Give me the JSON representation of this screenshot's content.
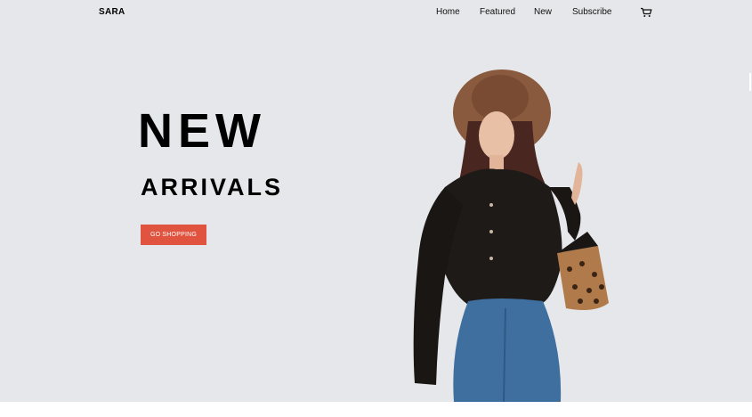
{
  "header": {
    "brand": "SARA",
    "nav": [
      {
        "label": "Home"
      },
      {
        "label": "Featured"
      },
      {
        "label": "New"
      },
      {
        "label": "Subscribe"
      }
    ],
    "cart_icon": "shopping-cart-icon"
  },
  "hero": {
    "headline_line1": "NEW",
    "headline_line2": "ARRIVALS",
    "cta_label": "GO SHOPPING",
    "image": "model-with-hat-leather-shirt-jeans-handbag"
  },
  "colors": {
    "hero_background": "#e6e7ea",
    "cta_background": "#e0533f",
    "text": "#000000"
  }
}
